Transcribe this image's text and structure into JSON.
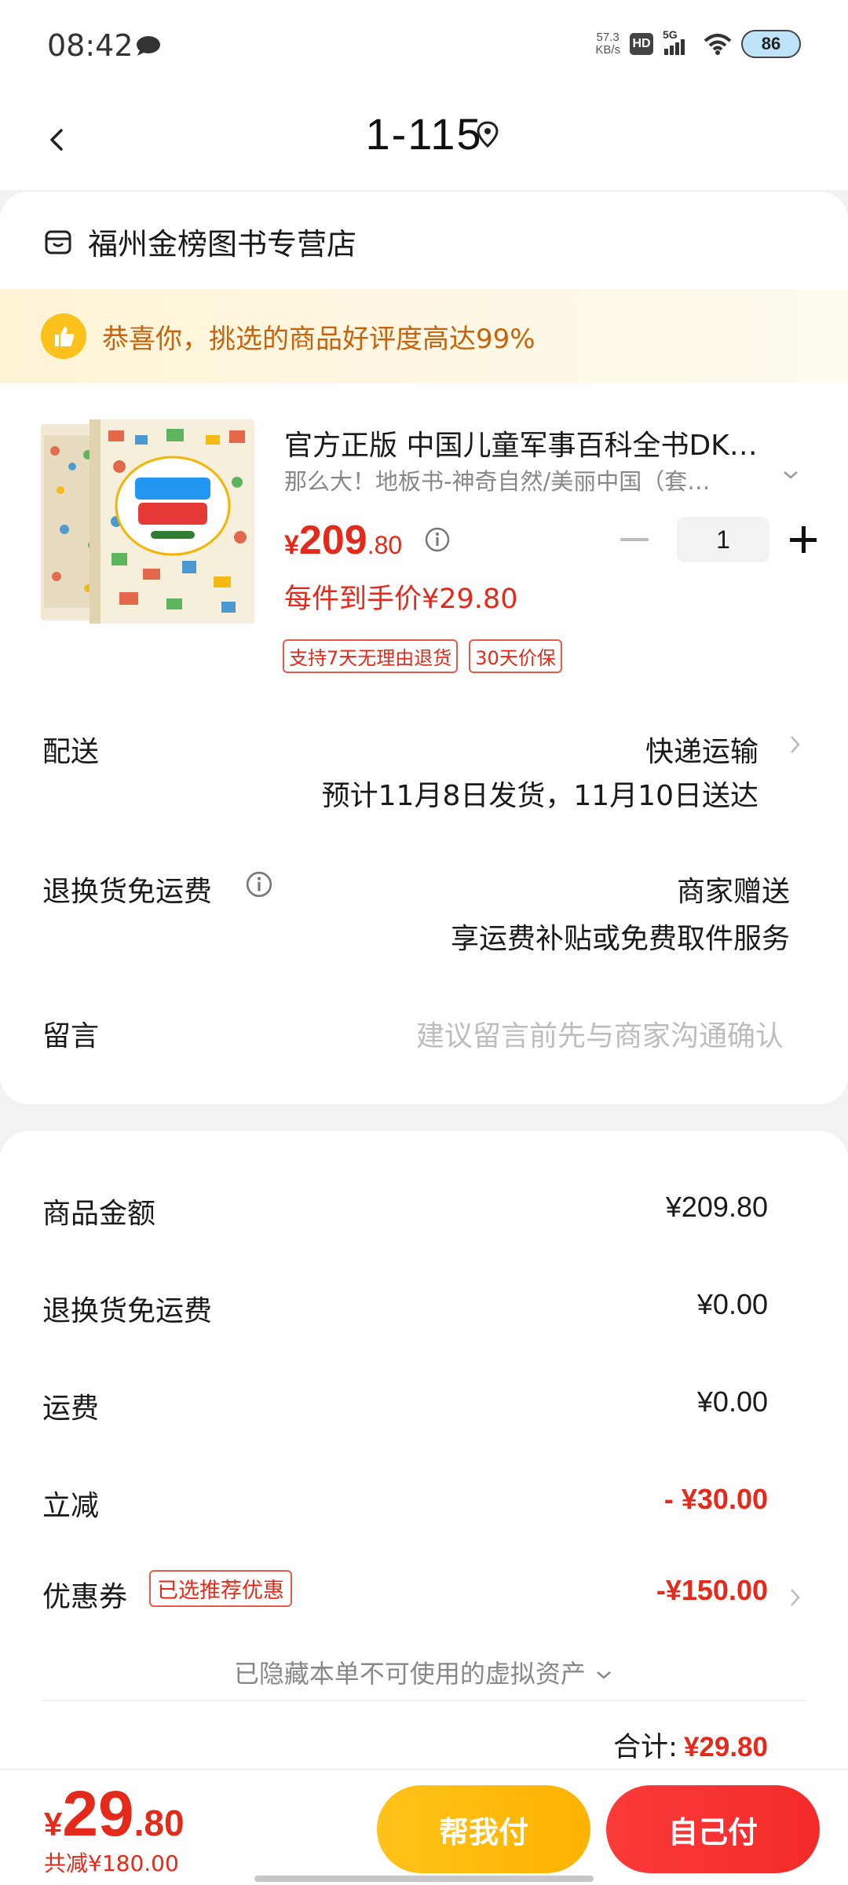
{
  "status_bar": {
    "time": "08:42",
    "net_speed_value": "57.3",
    "net_speed_unit": "KB/s",
    "hd": "HD",
    "network": "5G",
    "battery": "86"
  },
  "header": {
    "title": "1-115"
  },
  "store": {
    "name": "福州金榜图书专营店"
  },
  "banner": {
    "text": "恭喜你，挑选的商品好评度高达99%"
  },
  "product": {
    "title": "官方正版 中国儿童军事百科全书DK…",
    "variant": "那么大！地板书-神奇自然/美丽中国（套…",
    "price_currency": "¥",
    "price_int": "209",
    "price_dec": ".80",
    "quantity": "1",
    "unit_price": "每件到手价¥29.80",
    "tags": [
      "支持7天无理由退货",
      "30天价保"
    ]
  },
  "delivery": {
    "label": "配送",
    "method": "快递运输",
    "estimate": "预计11月8日发货，11月10日送达"
  },
  "return_shipping": {
    "label": "退换货免运费",
    "value": "商家赠送",
    "detail": "享运费补贴或免费取件服务"
  },
  "message": {
    "label": "留言",
    "placeholder": "建议留言前先与商家沟通确认"
  },
  "summary": {
    "goods_amount_label": "商品金额",
    "goods_amount": "¥209.80",
    "return_fee_label": "退换货免运费",
    "return_fee": "¥0.00",
    "shipping_label": "运费",
    "shipping": "¥0.00",
    "discount_label": "立减",
    "discount": "- ¥30.00",
    "coupon_label": "优惠券",
    "coupon_badge": "已选推荐优惠",
    "coupon": "-¥150.00",
    "hidden_assets": "已隐藏本单不可使用的虚拟资产",
    "total_label": "合计:",
    "total": "¥29.80"
  },
  "bottom_bar": {
    "currency": "¥",
    "price_int": "29",
    "price_dec": ".80",
    "total_saved": "共减¥180.00",
    "help_pay": "帮我付",
    "self_pay": "自己付"
  },
  "colors": {
    "accent_red": "#e42a1a",
    "help_button": "#ffc21a",
    "self_button": "#f32a2a",
    "banner_text": "#c8620c"
  }
}
